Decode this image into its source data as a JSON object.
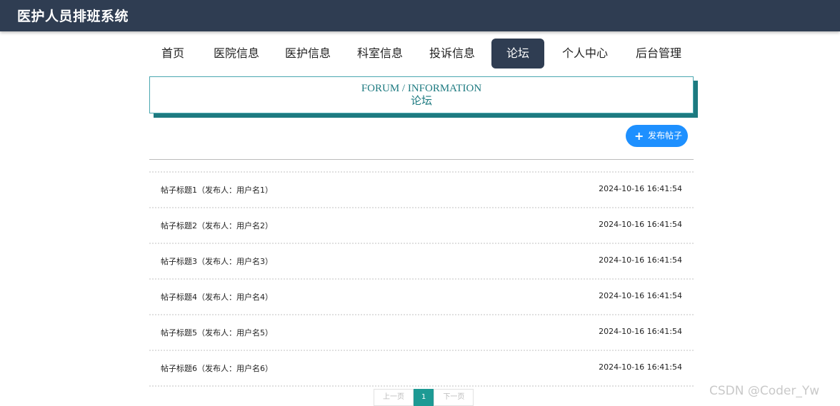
{
  "app": {
    "title": "医护人员排班系统"
  },
  "nav": {
    "items": [
      "首页",
      "医院信息",
      "医护信息",
      "科室信息",
      "投诉信息",
      "论坛",
      "个人中心",
      "后台管理"
    ],
    "active": "论坛"
  },
  "banner": {
    "en": "FORUM / INFORMATION",
    "cn": "论坛"
  },
  "actions": {
    "post_label": "发布帖子",
    "post_icon": "plus-icon"
  },
  "posts": [
    {
      "title": "帖子标题1（发布人：用户名1）",
      "time": "2024-10-16 16:41:54"
    },
    {
      "title": "帖子标题2（发布人：用户名2）",
      "time": "2024-10-16 16:41:54"
    },
    {
      "title": "帖子标题3（发布人：用户名3）",
      "time": "2024-10-16 16:41:54"
    },
    {
      "title": "帖子标题4（发布人：用户名4）",
      "time": "2024-10-16 16:41:54"
    },
    {
      "title": "帖子标题5（发布人：用户名5）",
      "time": "2024-10-16 16:41:54"
    },
    {
      "title": "帖子标题6（发布人：用户名6）",
      "time": "2024-10-16 16:41:54"
    }
  ],
  "pagination": {
    "prev": "上一页",
    "current": "1",
    "next": "下一页"
  },
  "watermark": "CSDN @Coder_Yw",
  "colors": {
    "header": "#2f3d52",
    "accent": "#1d7a80",
    "button": "#1e90ff",
    "page_active": "#1d9a94"
  }
}
